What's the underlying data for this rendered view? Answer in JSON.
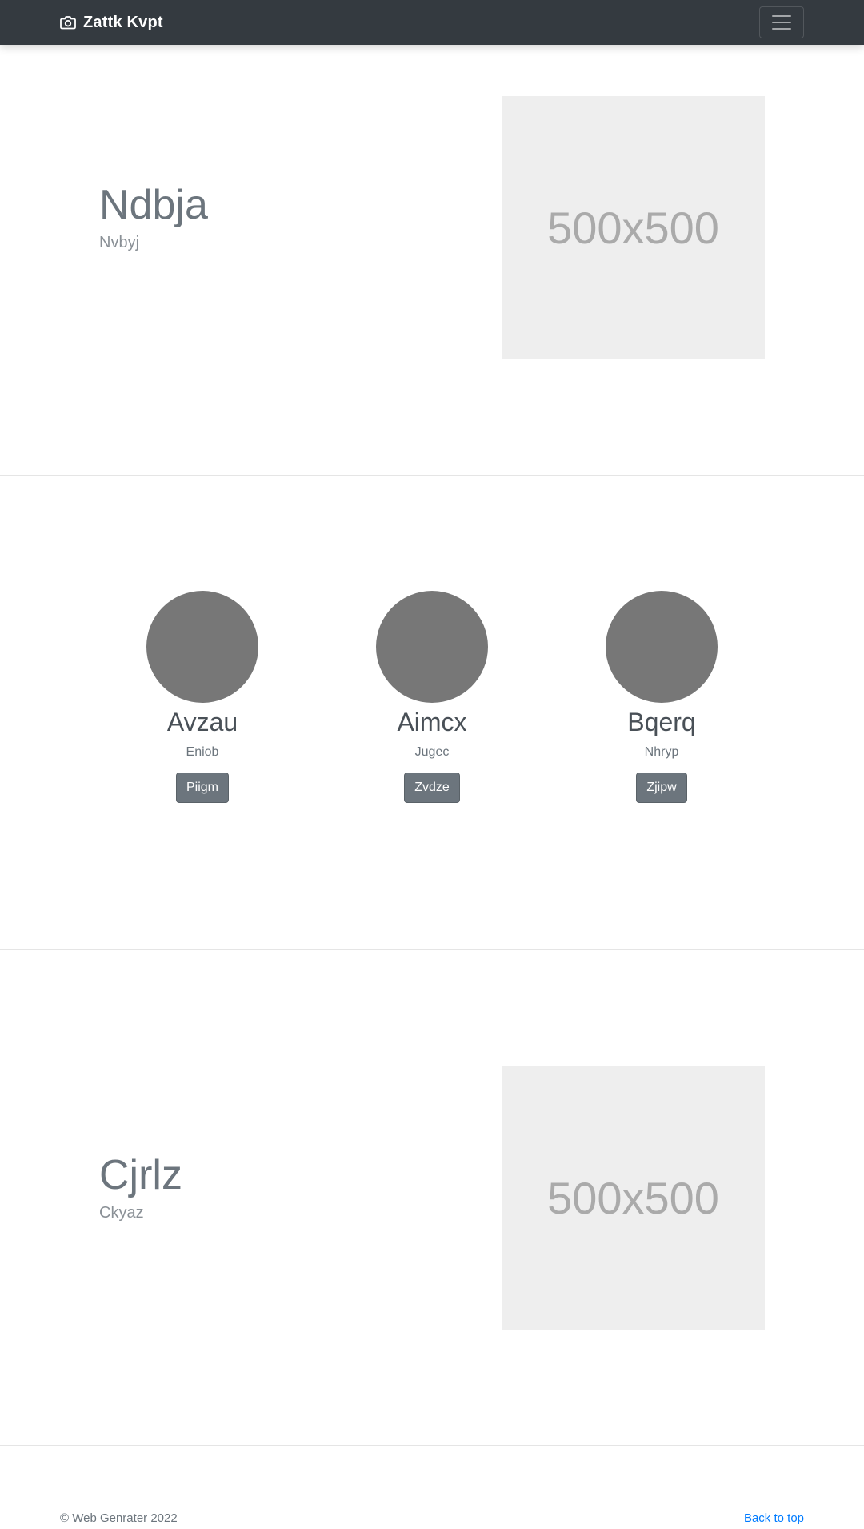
{
  "navbar": {
    "brand": "Zattk Kvpt",
    "brand_icon": "camera-icon",
    "menu_icon": "hamburger-menu-icon"
  },
  "hero1": {
    "title": "Ndbja",
    "subtitle": "Nvbyj",
    "image_label": "500x500"
  },
  "team": [
    {
      "name": "Avzau",
      "role": "Eniob",
      "button": "Piigm"
    },
    {
      "name": "Aimcx",
      "role": "Jugec",
      "button": "Zvdze"
    },
    {
      "name": "Bqerq",
      "role": "Nhryp",
      "button": "Zjipw"
    }
  ],
  "hero2": {
    "title": "Cjrlz",
    "subtitle": "Ckyaz",
    "image_label": "500x500"
  },
  "footer": {
    "copyright": "© Web Genrater 2022",
    "back_to_top": "Back to top"
  },
  "colors": {
    "navbar_bg": "#343a40",
    "button_bg": "#6c757d",
    "link": "#007bff",
    "avatar": "#777777",
    "placeholder_bg": "#eeeeee"
  }
}
